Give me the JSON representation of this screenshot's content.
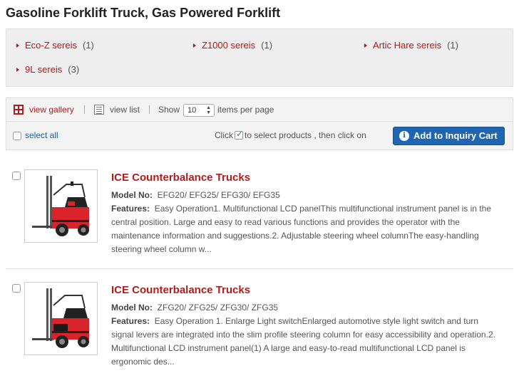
{
  "page": {
    "title": "Gasoline Forklift Truck, Gas Powered Forklift"
  },
  "series": [
    {
      "label": "Eco-Z sereis",
      "count": "(1)"
    },
    {
      "label": "Z1000 sereis",
      "count": "(1)"
    },
    {
      "label": "Artic Hare sereis",
      "count": "(1)"
    },
    {
      "label": "9L sereis",
      "count": "(3)"
    }
  ],
  "toolbar": {
    "view_gallery": "view gallery",
    "view_list": "view list",
    "show_label": "Show",
    "per_page_value": "10",
    "per_page_suffix": "items per page",
    "select_all": "select all",
    "instruction_before": "Click",
    "instruction_after": "to select products , then click on",
    "inquiry_button": "Add to Inquiry Cart"
  },
  "products": [
    {
      "title": "ICE Counterbalance Trucks",
      "model_label": "Model No:",
      "model_value": "EFG20/ EFG25/ EFG30/ EFG35",
      "features_label": "Features:",
      "features_text": "Easy Operation1. Multifunctional LCD panelThis multifunctional instrument panel is in the central position. Large and easy to read various functions and provides the operator with the maintenance information and suggestions.2. Adjustable steering wheel columnThe easy-handling steering wheel column w..."
    },
    {
      "title": "ICE Counterbalance Trucks",
      "model_label": "Model No:",
      "model_value": "ZFG20/ ZFG25/ ZFG30/ ZFG35",
      "features_label": "Features:",
      "features_text": "Easy Operation 1. Enlarge Light switchEnlarged automotive style light switch and turn signal levers are integrated into the slim profile steering column for easy accessibility and operation.2. Multifunctional LCD instrument panel(1) A large and easy-to-read multifunctional LCD panel is ergonomic des..."
    }
  ],
  "colors": {
    "link_red": "#b31b1b",
    "button_blue": "#1f65b2",
    "forklift_red": "#d8242a"
  }
}
